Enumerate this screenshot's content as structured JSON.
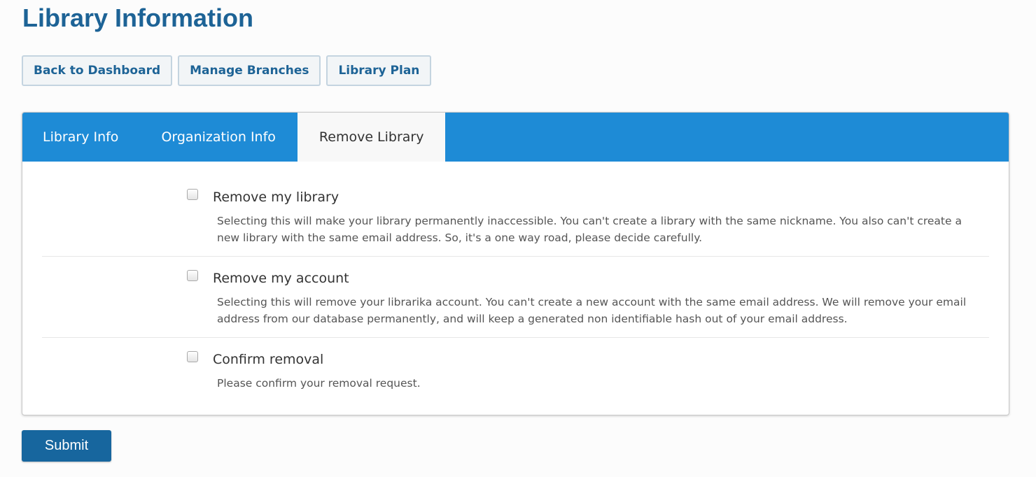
{
  "page": {
    "title": "Library Information"
  },
  "nav": {
    "back_label": "Back to Dashboard",
    "branches_label": "Manage Branches",
    "plan_label": "Library Plan"
  },
  "tabs": [
    {
      "label": "Library Info",
      "active": false
    },
    {
      "label": "Organization Info",
      "active": false
    },
    {
      "label": "Remove Library",
      "active": true
    }
  ],
  "options": [
    {
      "title": "Remove my library",
      "description": "Selecting this will make your library permanently inaccessible. You can't create a library with the same nickname. You also can't create a new library with the same email address. So, it's a one way road, please decide carefully.",
      "checked": false
    },
    {
      "title": "Remove my account",
      "description": "Selecting this will remove your librarika account. You can't create a new account with the same email address. We will remove your email address from our database permanently, and will keep a generated non identifiable hash out of your email address.",
      "checked": false
    },
    {
      "title": "Confirm removal",
      "description": "Please confirm your removal request.",
      "checked": false
    }
  ],
  "form": {
    "submit_label": "Submit"
  },
  "colors": {
    "title": "#1d6396",
    "tab_bar": "#1e8bd6",
    "submit": "#17669e"
  }
}
